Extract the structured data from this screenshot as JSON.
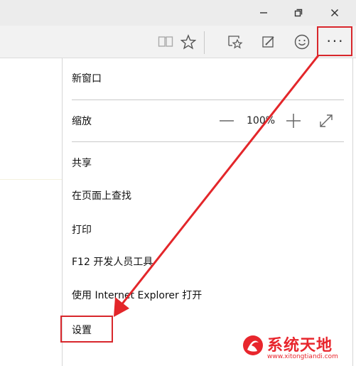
{
  "window_controls": {
    "minimize_icon": "minimize-icon",
    "maximize_icon": "restore-icon",
    "close_icon": "close-icon"
  },
  "toolbar": {
    "reading_view_icon": "book-icon",
    "favorite_icon": "star-icon",
    "hub_icon": "favorites-hub-icon",
    "web_note_icon": "pen-note-icon",
    "feedback_icon": "smiley-icon",
    "more_label": "···"
  },
  "menu": {
    "new_window": "新窗口",
    "zoom_label": "缩放",
    "zoom_value": "100%",
    "share": "共享",
    "find_on_page": "在页面上查找",
    "print": "打印",
    "dev_tools": "F12 开发人员工具",
    "open_ie": "使用 Internet Explorer 打开",
    "settings": "设置"
  },
  "watermark": {
    "title": "系统天地",
    "url": "www.xitongtiandi.com"
  },
  "colors": {
    "highlight": "#d8272c",
    "brand": "#e8262d"
  }
}
